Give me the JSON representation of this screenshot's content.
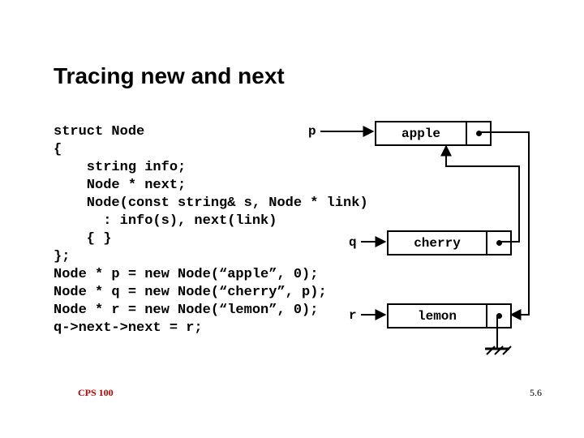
{
  "title": "Tracing new and next",
  "code": "struct Node\n{\n    string info;\n    Node * next;\n    Node(const string& s, Node * link)\n      : info(s), next(link)\n    { }\n};\nNode * p = new Node(“apple”, 0);\nNode * q = new Node(“cherry”, p);\nNode * r = new Node(“lemon”, 0);\nq->next->next = r;",
  "pointers": {
    "p": "p",
    "q": "q",
    "r": "r"
  },
  "nodes": {
    "apple": "apple",
    "cherry": "cherry",
    "lemon": "lemon"
  },
  "footer": {
    "left": "CPS 100",
    "right": "5.6"
  },
  "diagram": {
    "description": "Three heap-allocated Node boxes (apple, cherry, lemon), each with a next-pointer cell. Pointer p points to apple, q to cherry, r to lemon. cherry.next points to apple. After q->next->next = r, apple.next points down to lemon. lemon.next is grounded (null).",
    "links": [
      {
        "from": "p",
        "to": "apple"
      },
      {
        "from": "q",
        "to": "cherry"
      },
      {
        "from": "r",
        "to": "lemon"
      },
      {
        "from": "cherry.next",
        "to": "apple"
      },
      {
        "from": "apple.next",
        "to": "lemon"
      },
      {
        "from": "lemon.next",
        "to": "ground"
      }
    ]
  }
}
